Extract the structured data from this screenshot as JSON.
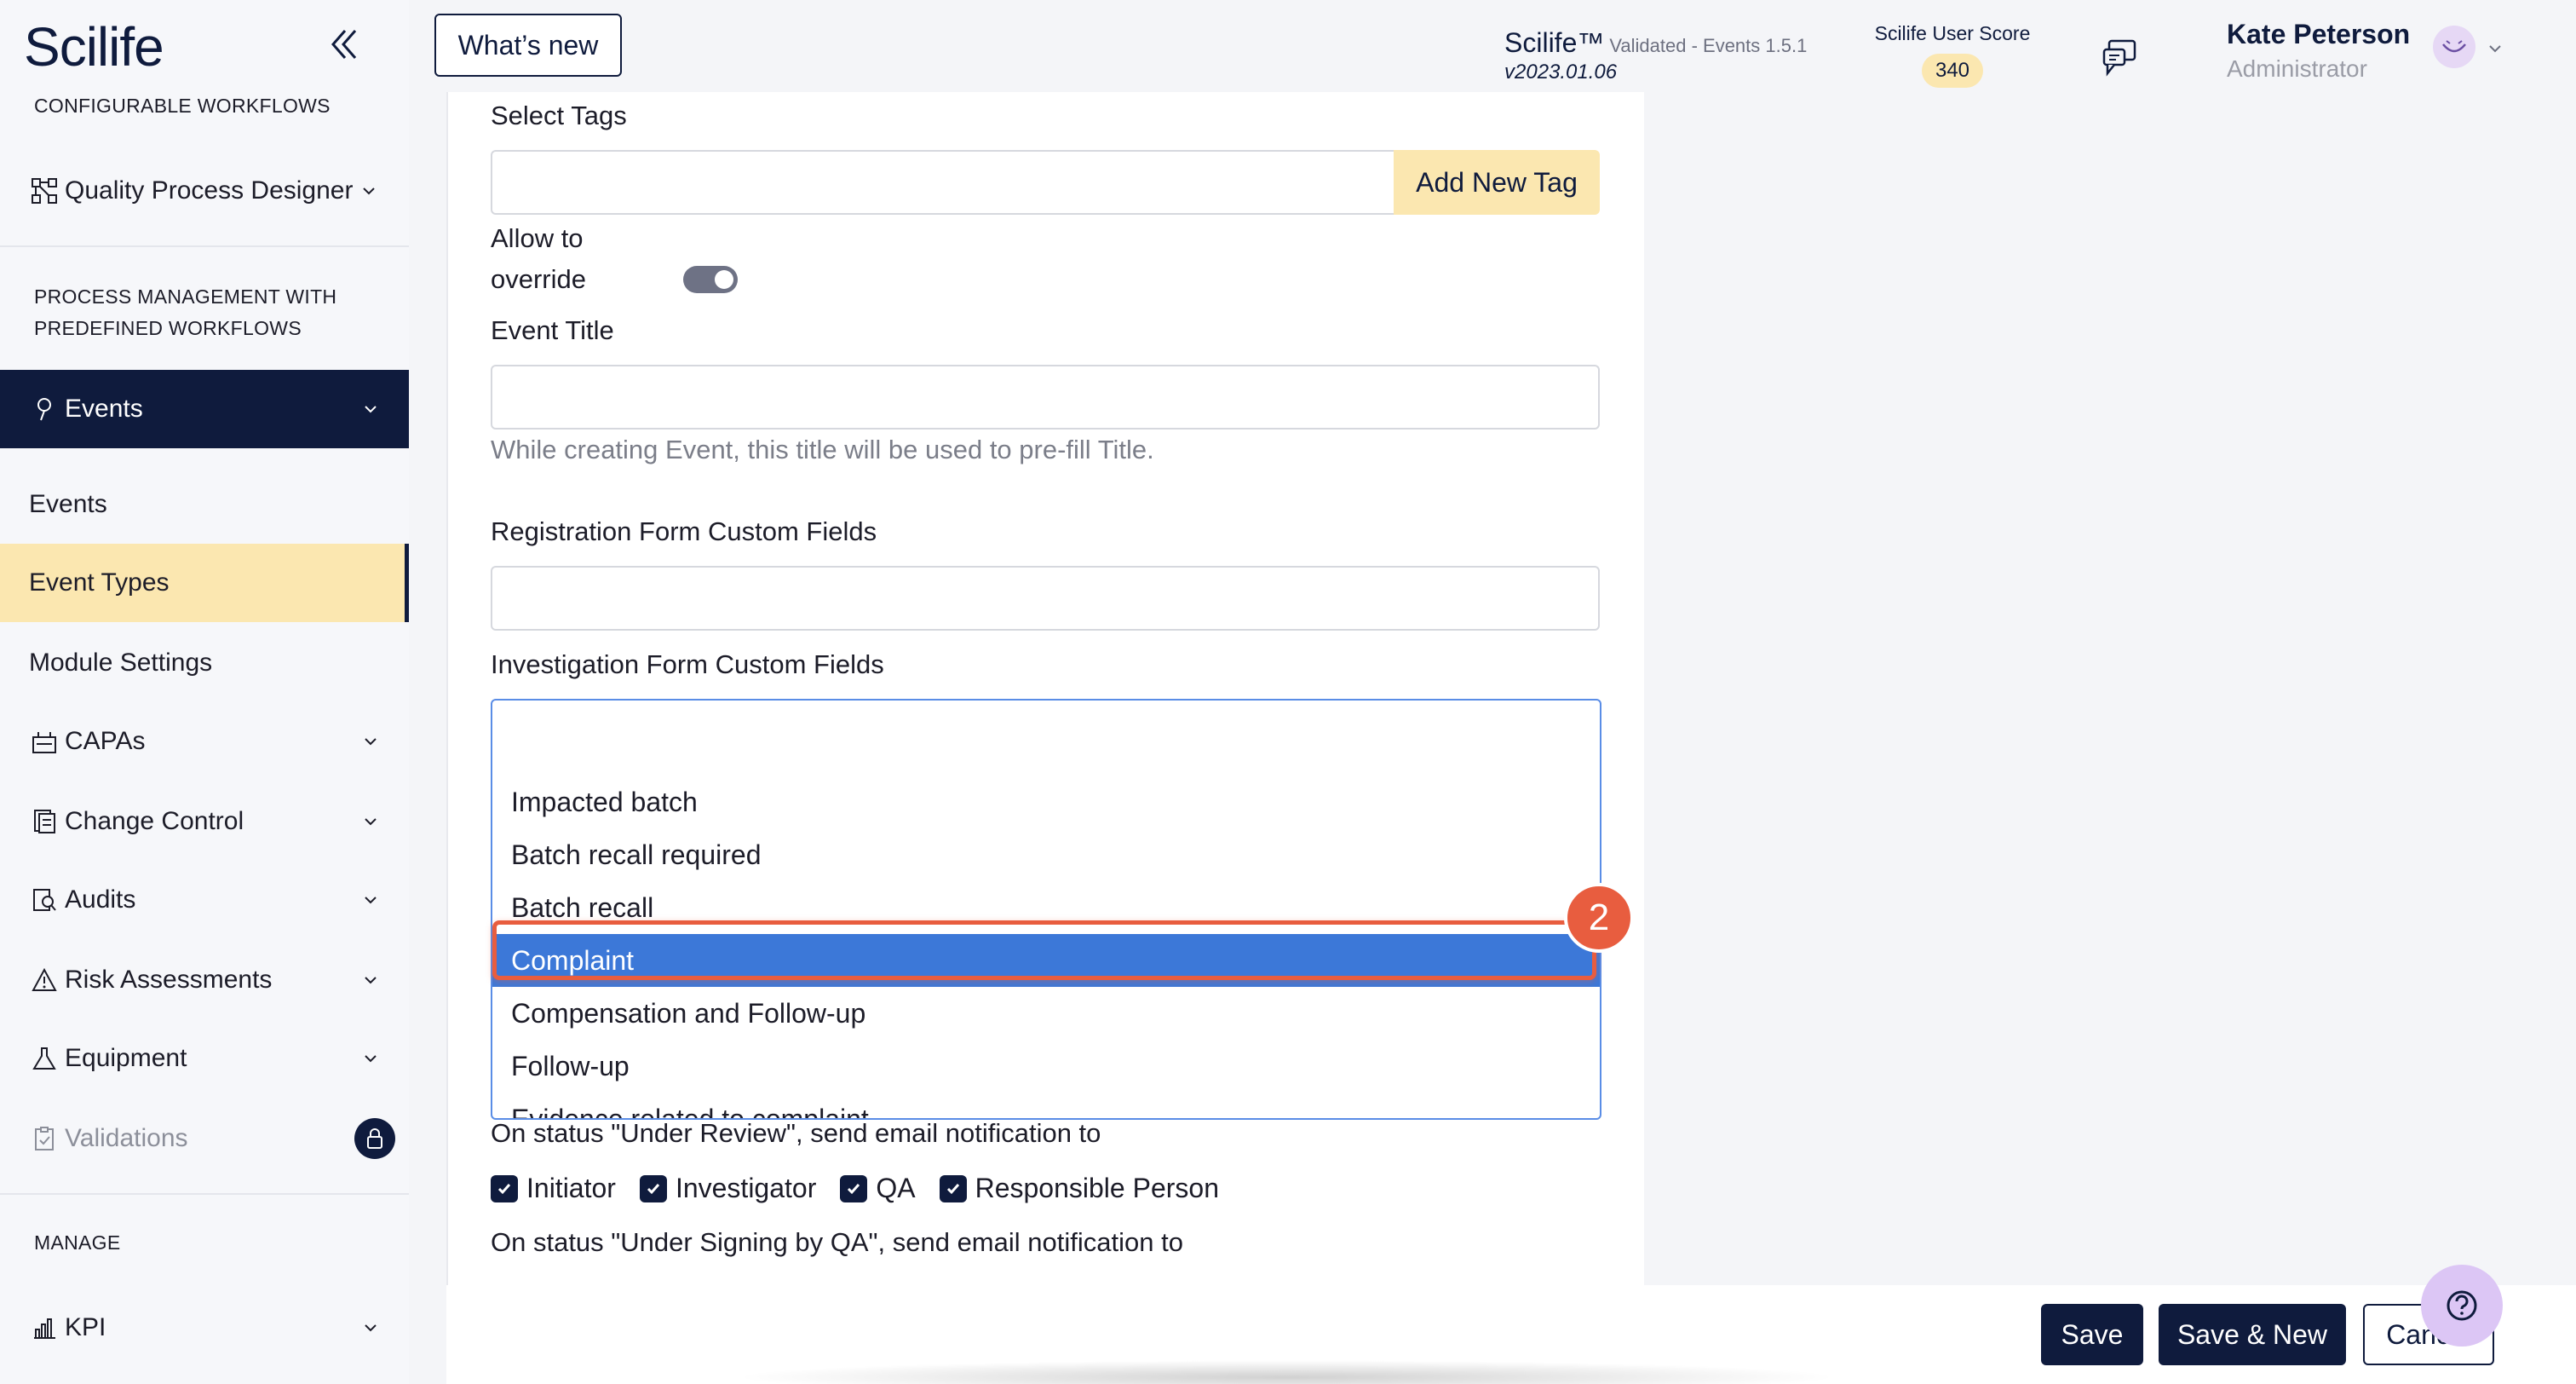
{
  "brand": {
    "logo_text": "Scilife"
  },
  "sidebar": {
    "section_configurable": "CONFIGURABLE WORKFLOWS",
    "quality_process_designer": "Quality Process Designer",
    "section_process_line1": "PROCESS MANAGEMENT WITH",
    "section_process_line2": "PREDEFINED WORKFLOWS",
    "events_group": "Events",
    "sub_events": "Events",
    "sub_event_types": "Event Types",
    "sub_module_settings": "Module Settings",
    "capas": "CAPAs",
    "change_control": "Change Control",
    "audits": "Audits",
    "risk_assessments": "Risk Assessments",
    "equipment": "Equipment",
    "validations": "Validations",
    "section_manage": "MANAGE",
    "kpi": "KPI"
  },
  "header": {
    "whats_new": "What’s new",
    "app_name": "Scilife™",
    "app_validated": "Validated - Events 1.5.1",
    "app_version": "v2023.01.06",
    "score_label": "Scilife User Score",
    "score_value": "340",
    "user_name": "Kate Peterson",
    "user_role": "Administrator"
  },
  "form": {
    "select_tags_label": "Select Tags",
    "add_new_tag": "Add New Tag",
    "allow_override_line1": "Allow to",
    "allow_override_line2": "override",
    "allow_override_on": true,
    "event_title_label": "Event Title",
    "event_title_hint": "While creating Event, this title will be used to pre-fill Title.",
    "registration_label": "Registration Form Custom Fields",
    "investigation_label": "Investigation Form Custom Fields",
    "investigation_options": [
      "Impacted batch",
      "Batch recall required",
      "Batch recall",
      "Complaint",
      "Compensation and Follow-up",
      "Follow-up",
      "Evidence related to complaint"
    ],
    "highlighted_option": "Complaint",
    "step_number": "2",
    "under_review_label": "On status \"Under Review\", send email notification to",
    "checkboxes": [
      "Initiator",
      "Investigator",
      "QA",
      "Responsible Person"
    ],
    "under_signing_label": "On status \"Under Signing by QA\", send email notification to"
  },
  "footer": {
    "save": "Save",
    "save_new": "Save & New",
    "cancel": "Cancel"
  },
  "colors": {
    "navy": "#0f1b3d",
    "highlight_yellow": "#fbe7b0",
    "selection_blue": "#3c78d8",
    "annotation_orange": "#e85d3f",
    "help_purple": "#dcc6f5"
  }
}
